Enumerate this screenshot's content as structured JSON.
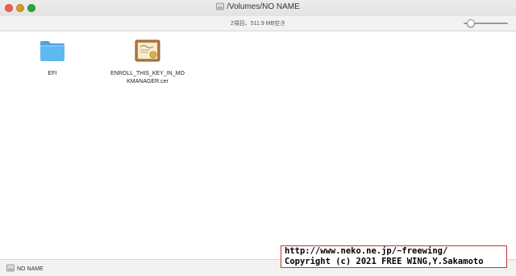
{
  "window": {
    "title": "/Volumes/NO NAME",
    "status": "2項目、511.9 MB空き"
  },
  "files": [
    {
      "name": "EFI",
      "icon": "folder-icon",
      "color": "#5fb8f0"
    },
    {
      "name": "ENROLL_THIS_KEY_IN_MOKMANAGER.cer",
      "line1": "ENROLL_THIS_KEY_IN_MO",
      "line2": "KMANAGER.cer",
      "icon": "certificate-icon"
    }
  ],
  "pathbar": {
    "label": "NO NAME"
  },
  "watermark": {
    "line1": "http://www.neko.ne.jp/~freewing/",
    "line2": "Copyright (c) 2021 FREE WING,Y.Sakamoto"
  }
}
